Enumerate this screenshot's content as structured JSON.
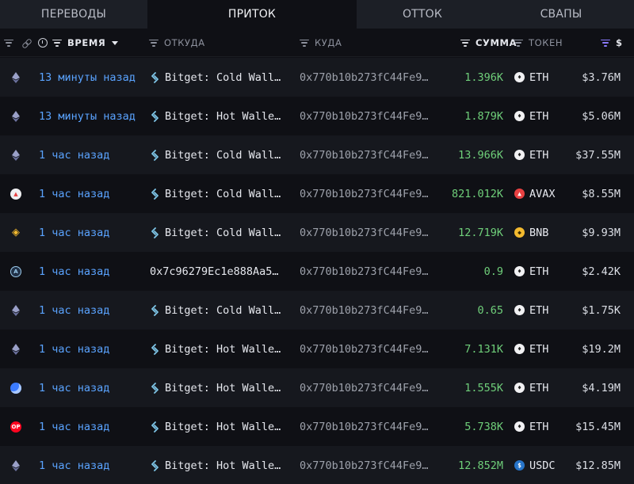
{
  "tabs": [
    {
      "label": "ПЕРЕВОДЫ"
    },
    {
      "label": "ПРИТОК"
    },
    {
      "label": "ОТТОК"
    },
    {
      "label": "СВАПЫ"
    }
  ],
  "columns": {
    "time": "ВРЕМЯ",
    "from": "ОТКУДА",
    "to": "КУДА",
    "amount": "СУММА",
    "token": "ТОКЕН",
    "usd": "$"
  },
  "rows": [
    {
      "chain": "ethereum",
      "time": "13 минуты назад",
      "from": "Bitget: Cold Wall…",
      "to": "0x770b10b273fC44Fe9…",
      "amount": "1.396K",
      "token": "ETH",
      "token_icon": "eth",
      "usd": "$3.76M"
    },
    {
      "chain": "ethereum",
      "time": "13 минуты назад",
      "from": "Bitget: Hot Walle…",
      "to": "0x770b10b273fC44Fe9…",
      "amount": "1.879K",
      "token": "ETH",
      "token_icon": "eth",
      "usd": "$5.06M"
    },
    {
      "chain": "ethereum",
      "time": "1 час назад",
      "from": "Bitget: Cold Wall…",
      "to": "0x770b10b273fC44Fe9…",
      "amount": "13.966K",
      "token": "ETH",
      "token_icon": "eth",
      "usd": "$37.55M"
    },
    {
      "chain": "avalanche",
      "time": "1 час назад",
      "from": "Bitget: Cold Wall…",
      "to": "0x770b10b273fC44Fe9…",
      "amount": "821.012K",
      "token": "AVAX",
      "token_icon": "avax",
      "usd": "$8.55M"
    },
    {
      "chain": "bnb",
      "time": "1 час назад",
      "from": "Bitget: Cold Wall…",
      "to": "0x770b10b273fC44Fe9…",
      "amount": "12.719K",
      "token": "BNB",
      "token_icon": "bnb",
      "usd": "$9.93M"
    },
    {
      "chain": "arbitrum",
      "time": "1 час назад",
      "from": "0x7c96279Ec1e888Aa5…",
      "to": "0x770b10b273fC44Fe9…",
      "amount": "0.9",
      "token": "ETH",
      "token_icon": "eth",
      "usd": "$2.42K",
      "no_swap_icon": true
    },
    {
      "chain": "ethereum",
      "time": "1 час назад",
      "from": "Bitget: Cold Wall…",
      "to": "0x770b10b273fC44Fe9…",
      "amount": "0.65",
      "token": "ETH",
      "token_icon": "eth",
      "usd": "$1.75K"
    },
    {
      "chain": "ethereum",
      "time": "1 час назад",
      "from": "Bitget: Hot Walle…",
      "to": "0x770b10b273fC44Fe9…",
      "amount": "7.131K",
      "token": "ETH",
      "token_icon": "eth",
      "usd": "$19.2M"
    },
    {
      "chain": "base",
      "time": "1 час назад",
      "from": "Bitget: Hot Walle…",
      "to": "0x770b10b273fC44Fe9…",
      "amount": "1.555K",
      "token": "ETH",
      "token_icon": "eth",
      "usd": "$4.19M"
    },
    {
      "chain": "optimism",
      "time": "1 час назад",
      "from": "Bitget: Hot Walle…",
      "to": "0x770b10b273fC44Fe9…",
      "amount": "5.738K",
      "token": "ETH",
      "token_icon": "eth",
      "usd": "$15.45M"
    },
    {
      "chain": "ethereum",
      "time": "1 час назад",
      "from": "Bitget: Hot Walle…",
      "to": "0x770b10b273fC44Fe9…",
      "amount": "12.852M",
      "token": "USDC",
      "token_icon": "usdc",
      "usd": "$12.85M"
    }
  ],
  "colors": {
    "time_link": "#5aa3ff",
    "amount_in": "#6fcf7a",
    "active_sort": "#8b7bff"
  }
}
